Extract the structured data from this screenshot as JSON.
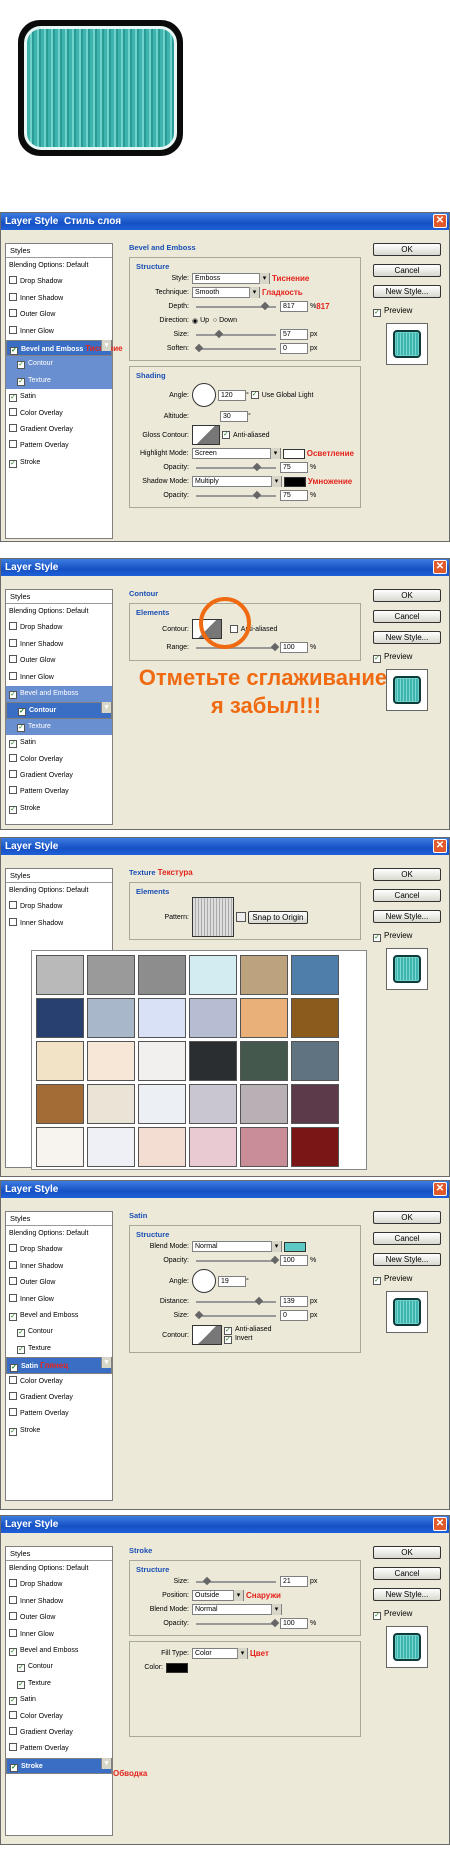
{
  "shared": {
    "ok": "OK",
    "cancel": "Cancel",
    "new_style": "New Style...",
    "preview": "Preview",
    "styles": "Styles",
    "blending": "Blending Options: Default",
    "items": [
      "Drop Shadow",
      "Inner Shadow",
      "Outer Glow",
      "Inner Glow",
      "Bevel and Emboss",
      "Contour",
      "Texture",
      "Satin",
      "Color Overlay",
      "Gradient Overlay",
      "Pattern Overlay",
      "Stroke"
    ]
  },
  "dialog1": {
    "title": "Layer Style",
    "title_note": "Стиль слоя",
    "bevel_note": "Тиснение",
    "section": "Bevel and Emboss",
    "structure": "Structure",
    "style_label": "Style:",
    "style_value": "Emboss",
    "style_note": "Тиснение",
    "technique_label": "Technique:",
    "technique_value": "Smooth",
    "technique_note": "Гладкость",
    "depth_label": "Depth:",
    "depth_value": "817",
    "depth_unit": "%",
    "depth_note": "817",
    "direction_label": "Direction:",
    "up": "Up",
    "down": "Down",
    "size_label": "Size:",
    "size_value": "57",
    "size_unit": "px",
    "soften_label": "Soften:",
    "soften_value": "0",
    "soften_unit": "px",
    "shading": "Shading",
    "angle_label": "Angle:",
    "angle_value": "120",
    "angle_unit": "°",
    "global_light": "Use Global Light",
    "altitude_label": "Altitude:",
    "altitude_value": "30",
    "altitude_unit": "°",
    "gloss_label": "Gloss Contour:",
    "anti_aliased": "Anti-aliased",
    "highlight_label": "Highlight Mode:",
    "highlight_value": "Screen",
    "highlight_note": "Осветление",
    "opacity_label": "Opacity:",
    "h_opacity": "75",
    "pct": "%",
    "shadow_label": "Shadow Mode:",
    "shadow_value": "Multiply",
    "shadow_note": "Умножение",
    "s_opacity": "75"
  },
  "dialog2": {
    "title": "Layer Style",
    "section": "Contour",
    "elements": "Elements",
    "contour_label": "Contour:",
    "anti_aliased": "Anti-aliased",
    "range_label": "Range:",
    "range_value": "100",
    "range_unit": "%",
    "overlay_line1": "Отметьте сглаживание,",
    "overlay_line2": "я забыл!!!"
  },
  "dialog3": {
    "title": "Layer Style",
    "section": "Texture",
    "section_note": "Текстура",
    "elements": "Elements",
    "pattern_label": "Pattern:",
    "snap": "Snap to Origin"
  },
  "dialog4": {
    "title": "Layer Style",
    "section": "Satin",
    "structure": "Structure",
    "satin_note": "Глянец",
    "blend_label": "Blend Mode:",
    "blend_value": "Normal",
    "opacity_label": "Opacity:",
    "opacity_value": "100",
    "pct": "%",
    "angle_label": "Angle:",
    "angle_value": "19",
    "angle_unit": "°",
    "distance_label": "Distance:",
    "distance_value": "139",
    "px": "px",
    "size_label": "Size:",
    "size_value": "0",
    "contour_label": "Contour:",
    "anti_aliased": "Anti-aliased",
    "invert": "Invert",
    "satin_color": "#5ec8c4"
  },
  "dialog5": {
    "title": "Layer Style",
    "section": "Stroke",
    "structure": "Structure",
    "size_label": "Size:",
    "size_value": "21",
    "px": "px",
    "position_label": "Position:",
    "position_value": "Outside",
    "position_note": "Снаружи",
    "blend_label": "Blend Mode:",
    "blend_value": "Normal",
    "opacity_label": "Opacity:",
    "opacity_value": "100",
    "pct": "%",
    "fill_label": "Fill Type:",
    "fill_value": "Color",
    "fill_note": "Цвет",
    "color_label": "Color:",
    "stroke_note": "Обводка"
  }
}
